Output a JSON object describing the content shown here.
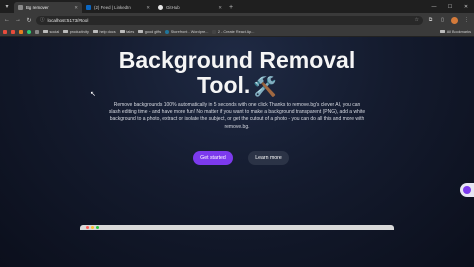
{
  "browser": {
    "tabs": [
      {
        "label": "Bg remover",
        "favicon_color": "#8a8a8a",
        "active": true
      },
      {
        "label": "(2) Feed | LinkedIn",
        "favicon_color": "#0a66c2",
        "active": false
      },
      {
        "label": "GitHub",
        "favicon_color": "#e6e6e6",
        "active": false
      }
    ],
    "new_tab": "+",
    "window_controls": {
      "minimize": "—",
      "maximize": "☐",
      "close": "✕"
    },
    "url": "localhost:5173/#tool",
    "bookmarks": [
      {
        "label": "",
        "color": "#e84c3d"
      },
      {
        "label": "",
        "color": "#e74c3c"
      },
      {
        "label": "",
        "color": "#e67e22"
      },
      {
        "label": "",
        "color": "#2ecc71"
      },
      {
        "label": "",
        "color": "#888888"
      },
      {
        "label": "social",
        "color": "folder"
      },
      {
        "label": "productivity",
        "color": "folder"
      },
      {
        "label": "help docs",
        "color": "folder"
      },
      {
        "label": "tales",
        "color": "folder"
      },
      {
        "label": "good gifts",
        "color": "folder"
      },
      {
        "label": "Storefront - Wordpre...",
        "color": "#21759b"
      },
      {
        "label": "2 - Create React Ap...",
        "color": "#444444"
      }
    ],
    "all_bookmarks": "All Bookmarks"
  },
  "hero": {
    "title_line1": "Background Removal",
    "title_line2": "Tool.",
    "tools_icon": "🛠️",
    "description": "Remove backgrounds 100% automatically in 5 seconds with one click Thanks to remove.bg's clever AI, you can slash editing time - and have more fun! No matter if you want to make a background transparent (PNG), add a white background to a photo, extract or isolate the subject, or get the cutout of a photo - you can do all this and more with remove.bg.",
    "primary_button": "Get started",
    "secondary_button": "Learn more"
  },
  "colors": {
    "accent": "#7c3aed",
    "page_bg": "#141b2e"
  }
}
